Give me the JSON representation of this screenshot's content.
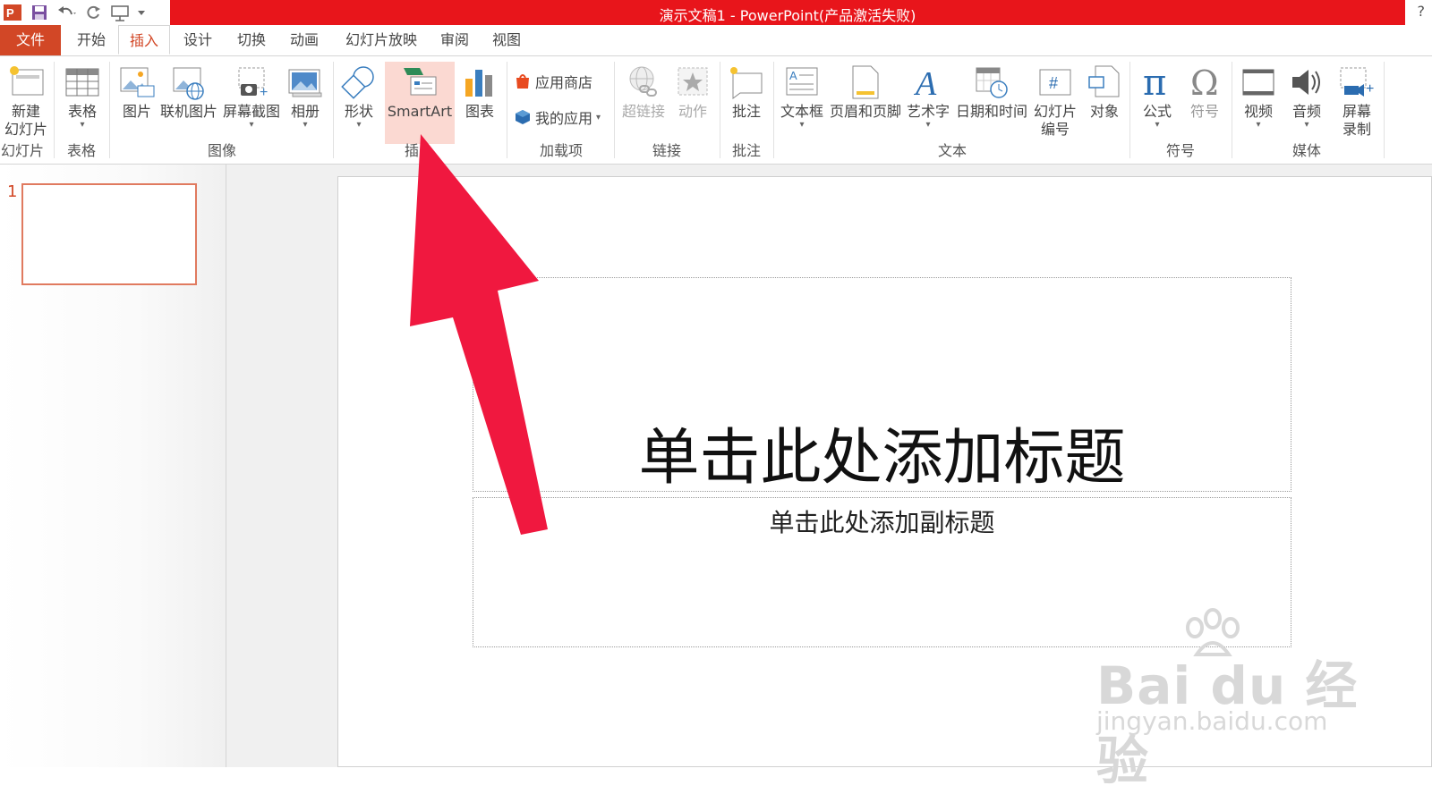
{
  "window": {
    "title": "演示文稿1 - PowerPoint(产品激活失败)",
    "help": "?"
  },
  "tabs": [
    {
      "label": "文件"
    },
    {
      "label": "开始"
    },
    {
      "label": "插入"
    },
    {
      "label": "设计"
    },
    {
      "label": "切换"
    },
    {
      "label": "动画"
    },
    {
      "label": "幻灯片放映"
    },
    {
      "label": "审阅"
    },
    {
      "label": "视图"
    }
  ],
  "active_tab": "插入",
  "ribbon": {
    "new_slide": "新建\n幻灯片",
    "new_slide_l1": "新建",
    "new_slide_l2": "幻灯片",
    "table": "表格",
    "picture": "图片",
    "online_picture": "联机图片",
    "screenshot": "屏幕截图",
    "album": "相册",
    "shape": "形状",
    "smartart": "SmartArt",
    "chart": "图表",
    "store": "应用商店",
    "my_apps": "我的应用",
    "hyperlink": "超链接",
    "action": "动作",
    "comment": "批注",
    "textbox": "文本框",
    "header_footer": "页眉和页脚",
    "wordart": "艺术字",
    "datetime": "日期和时间",
    "slide_number_l1": "幻灯片",
    "slide_number_l2": "编号",
    "object": "对象",
    "equation": "公式",
    "symbol": "符号",
    "video": "视频",
    "audio": "音频",
    "screen_rec_l1": "屏幕",
    "screen_rec_l2": "录制",
    "groups": {
      "slides": "幻灯片",
      "tables": "表格",
      "images": "图像",
      "illustrations": "插",
      "addins": "加载项",
      "links": "链接",
      "comments": "批注",
      "text": "文本",
      "symbols": "符号",
      "media": "媒体"
    }
  },
  "slides_pane": {
    "slide_number": "1"
  },
  "slide": {
    "title_placeholder": "单击此处添加标题",
    "subtitle_placeholder": "单击此处添加副标题"
  },
  "watermark": {
    "brand": "Bai du 经验",
    "url": "jingyan.baidu.com"
  },
  "colors": {
    "title_bar": "#e8151b",
    "accent": "#d24726",
    "highlight": "#fbd9d2",
    "arrow": "#f0183f"
  }
}
